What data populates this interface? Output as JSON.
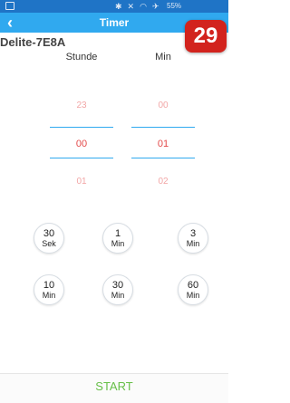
{
  "status_bar": {
    "icons": [
      "bluetooth-icon",
      "mute-icon",
      "wifi-icon",
      "airplane-icon"
    ],
    "battery": "55%"
  },
  "header": {
    "back_glyph": "‹",
    "title": "Timer",
    "badge": "29",
    "color": "#30a9ef",
    "status_color": "#1f74c6"
  },
  "device_name": "Delite-7E8A",
  "picker": {
    "hour_label": "Stunde",
    "minute_label": "Min",
    "hour": {
      "prev": "23",
      "selected": "00",
      "next": "01"
    },
    "minute": {
      "prev": "00",
      "selected": "01",
      "next": "02"
    }
  },
  "presets": [
    {
      "value": "30",
      "unit": "Sek"
    },
    {
      "value": "1",
      "unit": "Min"
    },
    {
      "value": "3",
      "unit": "Min"
    },
    {
      "value": "10",
      "unit": "Min"
    },
    {
      "value": "30",
      "unit": "Min"
    },
    {
      "value": "60",
      "unit": "Min"
    }
  ],
  "start_label": "START",
  "colors": {
    "selected": "#e34a4a",
    "faded": "#f2a6a6",
    "start": "#66bf47",
    "badge": "#d2231d"
  }
}
